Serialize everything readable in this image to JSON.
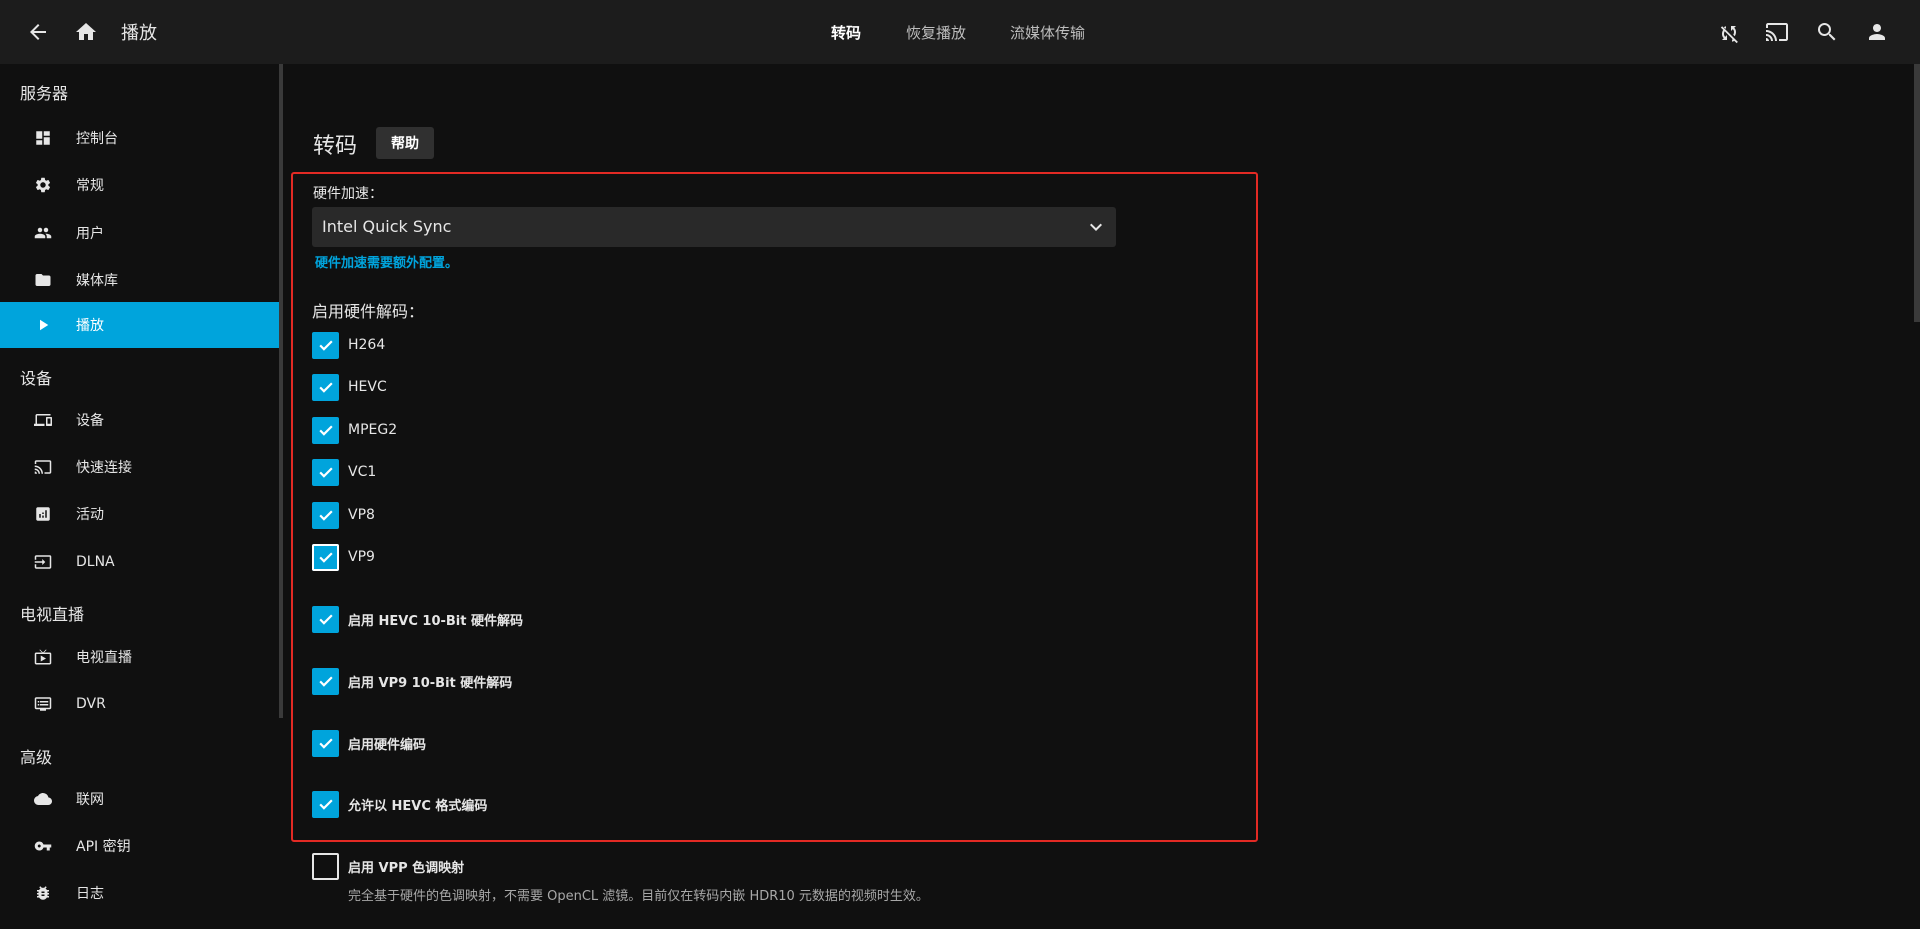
{
  "topbar": {
    "title": "播放",
    "tabs": [
      {
        "label": "转码",
        "active": true
      },
      {
        "label": "恢复播放",
        "active": false
      },
      {
        "label": "流媒体传输",
        "active": false
      }
    ]
  },
  "sidebar": {
    "sections": [
      {
        "title": "服务器",
        "items": [
          {
            "label": "控制台",
            "icon": "dashboard-icon"
          },
          {
            "label": "常规",
            "icon": "gear-icon"
          },
          {
            "label": "用户",
            "icon": "people-icon"
          },
          {
            "label": "媒体库",
            "icon": "folder-icon"
          },
          {
            "label": "播放",
            "icon": "play-icon",
            "active": true
          }
        ]
      },
      {
        "title": "设备",
        "items": [
          {
            "label": "设备",
            "icon": "devices-icon"
          },
          {
            "label": "快速连接",
            "icon": "cast-connect-icon"
          },
          {
            "label": "活动",
            "icon": "analytics-icon"
          },
          {
            "label": "DLNA",
            "icon": "input-icon"
          }
        ]
      },
      {
        "title": "电视直播",
        "items": [
          {
            "label": "电视直播",
            "icon": "live-tv-icon"
          },
          {
            "label": "DVR",
            "icon": "dvr-icon"
          }
        ]
      },
      {
        "title": "高级",
        "items": [
          {
            "label": "联网",
            "icon": "cloud-icon"
          },
          {
            "label": "API 密钥",
            "icon": "key-icon"
          },
          {
            "label": "日志",
            "icon": "bug-icon"
          }
        ]
      }
    ]
  },
  "main": {
    "title": "转码",
    "help_label": "帮助",
    "hw_accel": {
      "label": "硬件加速：",
      "value": "Intel Quick Sync",
      "note": "硬件加速需要额外配置。"
    },
    "decode_label": "启用硬件解码：",
    "codecs": [
      {
        "label": "H264",
        "checked": true
      },
      {
        "label": "HEVC",
        "checked": true
      },
      {
        "label": "MPEG2",
        "checked": true
      },
      {
        "label": "VC1",
        "checked": true
      },
      {
        "label": "VP8",
        "checked": true
      },
      {
        "label": "VP9",
        "checked": true
      }
    ],
    "options": [
      {
        "label": "启用 HEVC 10-Bit 硬件解码",
        "checked": true
      },
      {
        "label": "启用 VP9 10-Bit 硬件解码",
        "checked": true
      },
      {
        "label": "启用硬件编码",
        "checked": true
      },
      {
        "label": "允许以 HEVC 格式编码",
        "checked": true
      },
      {
        "label": "启用 VPP 色调映射",
        "checked": false
      }
    ],
    "vpp_description": "完全基于硬件的色调映射，不需要 OpenCL 滤镜。目前仅在转码内嵌 HDR10 元数据的视频时生效。"
  },
  "colors": {
    "accent": "#00a4dc",
    "highlight_box": "#e22a24",
    "background": "#101010",
    "topbar": "#1c1c1c"
  }
}
